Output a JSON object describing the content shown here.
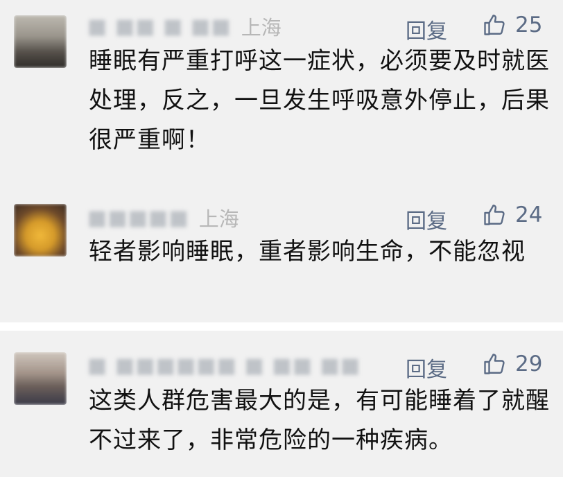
{
  "comments": [
    {
      "name": "■ ■■ ■ ■■",
      "location": "上海",
      "reply_label": "回复",
      "likes": "25",
      "text": "睡眠有严重打呼这一症状，必须要及时就医处理，反之，一旦发生呼吸意外停止，后果很严重啊！"
    },
    {
      "name": "■■■■■",
      "location": "上海",
      "reply_label": "回复",
      "likes": "24",
      "text": "轻者影响睡眠，重者影响生命，不能忽视"
    },
    {
      "name": "■ ■■■■■■ ■ ■■   ■■",
      "location": "",
      "reply_label": "回复",
      "likes": "29",
      "text": "这类人群危害最大的是，有可能睡着了就醒不过来了，非常危险的一种疾病。"
    }
  ],
  "icons": {
    "like": "thumbs-up-icon",
    "avatar": "blurred-avatar"
  },
  "colors": {
    "link": "#5b6b85",
    "location": "#b7b7b7",
    "background": "#f1f1f1"
  }
}
